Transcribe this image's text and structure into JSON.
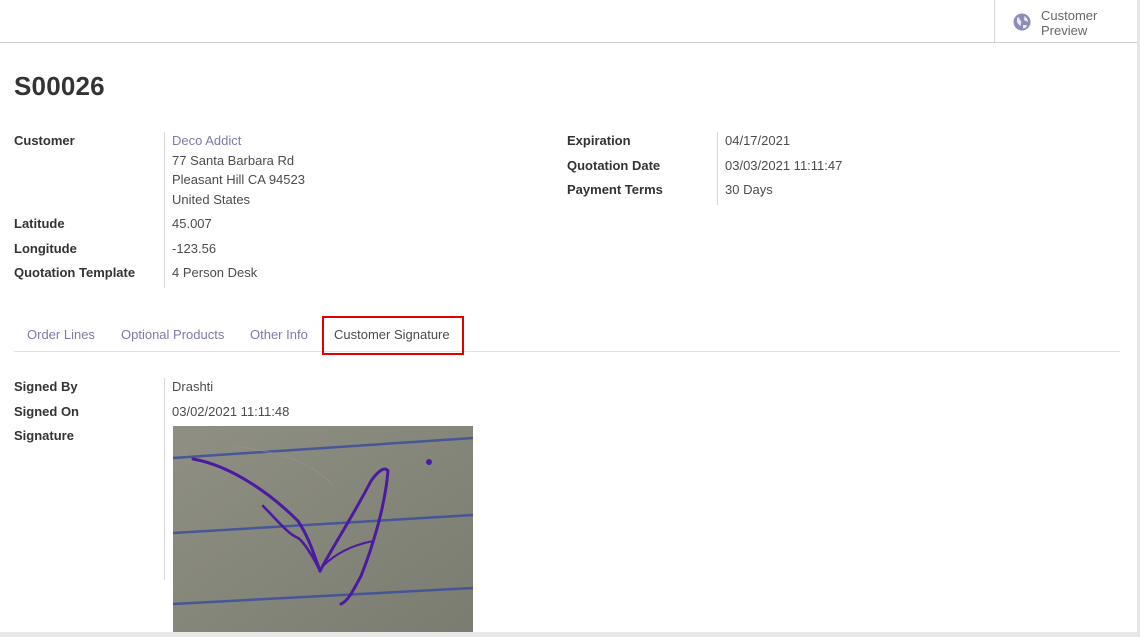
{
  "header": {
    "preview_button": {
      "label": "Customer Preview",
      "icon": "globe-icon"
    }
  },
  "record": {
    "name": "S00026"
  },
  "left_fields": {
    "customer": {
      "label": "Customer",
      "name": "Deco Addict",
      "address_line1": "77 Santa Barbara Rd",
      "address_line2": "Pleasant Hill CA 94523",
      "address_line3": "United States"
    },
    "latitude": {
      "label": "Latitude",
      "value": "45.007"
    },
    "longitude": {
      "label": "Longitude",
      "value": "-123.56"
    },
    "template": {
      "label": "Quotation Template",
      "value": "4 Person Desk"
    }
  },
  "right_fields": {
    "expiration": {
      "label": "Expiration",
      "value": "04/17/2021"
    },
    "quotation_date": {
      "label": "Quotation Date",
      "value": "03/03/2021 11:11:47"
    },
    "payment_terms": {
      "label": "Payment Terms",
      "value": "30 Days"
    }
  },
  "tabs": [
    {
      "label": "Order Lines"
    },
    {
      "label": "Optional Products"
    },
    {
      "label": "Other Info"
    },
    {
      "label": "Customer Signature",
      "active": true
    }
  ],
  "signature_tab": {
    "signed_by": {
      "label": "Signed By",
      "value": "Drashti"
    },
    "signed_on": {
      "label": "Signed On",
      "value": "03/02/2021 11:11:48"
    },
    "signature": {
      "label": "Signature"
    }
  },
  "colors": {
    "link": "#7c7bad",
    "highlight": "#e00000",
    "ink": "#4b1aa0",
    "paper": "#8a8a7c",
    "ruled_line": "#3c4e9c"
  }
}
